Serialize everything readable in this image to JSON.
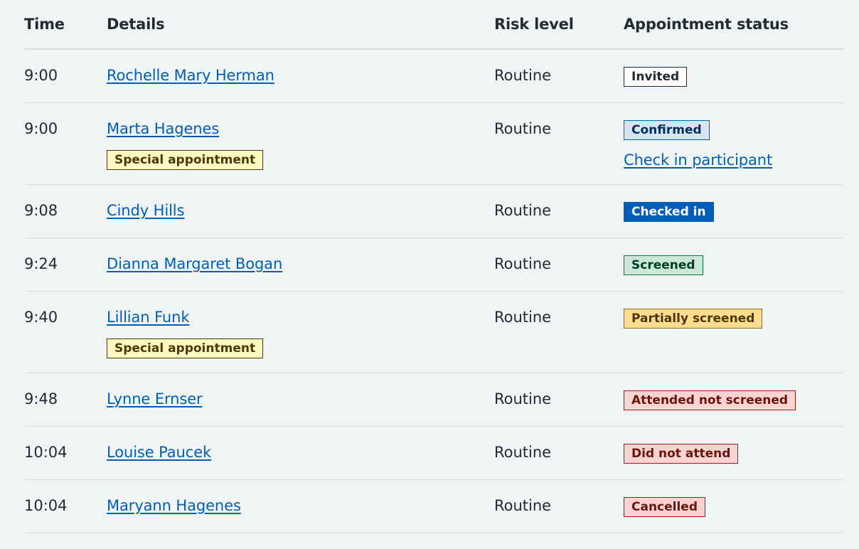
{
  "table": {
    "headers": {
      "time": "Time",
      "details": "Details",
      "risk": "Risk level",
      "status": "Appointment status"
    },
    "rows": [
      {
        "time": "9:00",
        "name": "Rochelle Mary Herman",
        "special": "",
        "risk": "Routine",
        "status": "Invited",
        "status_style": "white",
        "action": ""
      },
      {
        "time": "9:00",
        "name": "Marta Hagenes",
        "special": "Special appointment",
        "risk": "Routine",
        "status": "Confirmed",
        "status_style": "blue-light",
        "action": "Check in participant"
      },
      {
        "time": "9:08",
        "name": "Cindy Hills",
        "special": "",
        "risk": "Routine",
        "status": "Checked in",
        "status_style": "blue",
        "action": ""
      },
      {
        "time": "9:24",
        "name": "Dianna Margaret Bogan",
        "special": "",
        "risk": "Routine",
        "status": "Screened",
        "status_style": "green",
        "action": ""
      },
      {
        "time": "9:40",
        "name": "Lillian Funk",
        "special": "Special appointment",
        "risk": "Routine",
        "status": "Partially screened",
        "status_style": "orange",
        "action": ""
      },
      {
        "time": "9:48",
        "name": "Lynne Ernser",
        "special": "",
        "risk": "Routine",
        "status": "Attended not screened",
        "status_style": "red",
        "action": ""
      },
      {
        "time": "10:04",
        "name": "Louise Paucek",
        "special": "",
        "risk": "Routine",
        "status": "Did not attend",
        "status_style": "red",
        "action": ""
      },
      {
        "time": "10:04",
        "name": "Maryann Hagenes",
        "special": "",
        "risk": "Routine",
        "status": "Cancelled",
        "status_style": "red",
        "action": ""
      }
    ]
  },
  "colors": {
    "background": "#f0f4f5",
    "link": "#005eb8",
    "text": "#212b32"
  }
}
